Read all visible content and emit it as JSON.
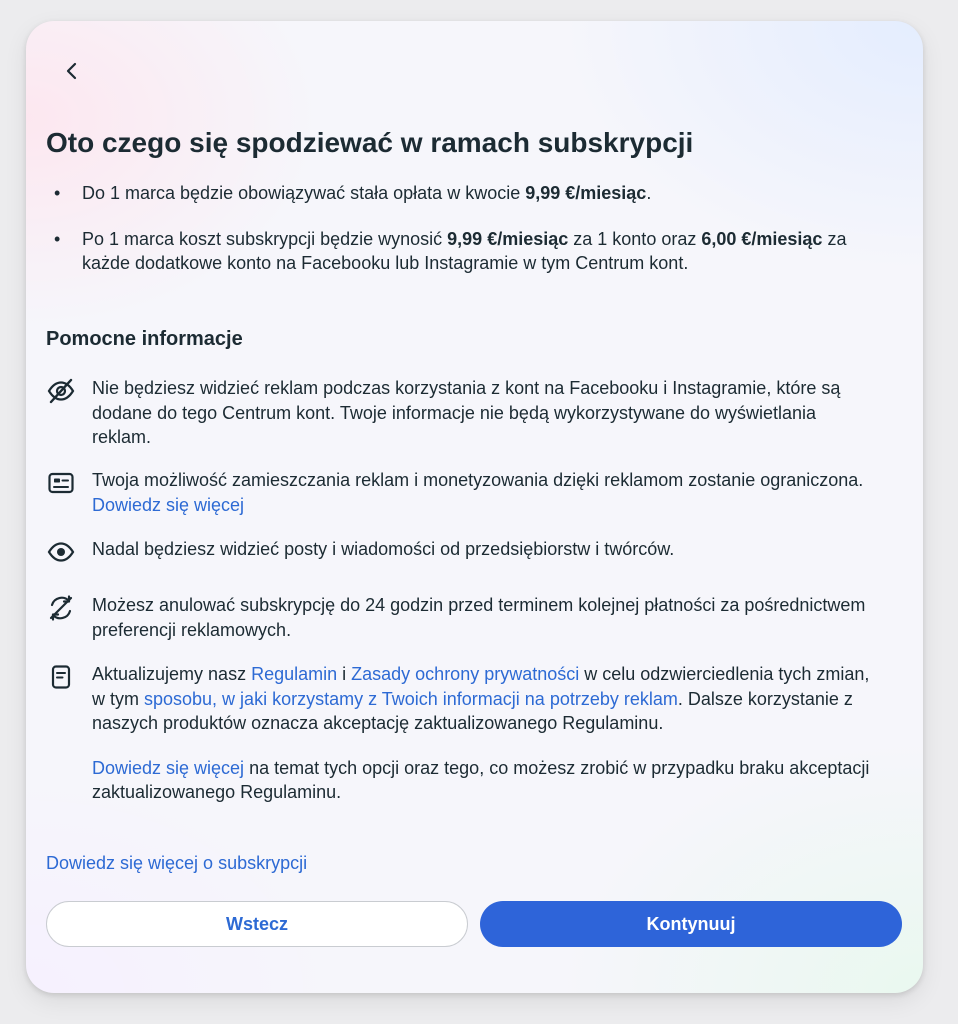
{
  "title": "Oto czego się spodziewać w ramach subskrypcji",
  "bullets": [
    {
      "marker": "•",
      "part1": "Do 1 marca będzie obowiązywać stała opłata w kwocie ",
      "bold1": "9,99 €/miesiąc",
      "part2": "."
    },
    {
      "marker": "•",
      "part1": "Po 1 marca koszt subskrypcji będzie wynosić ",
      "bold1": "9,99 €/miesiąc",
      "part2": " za 1 konto oraz ",
      "bold2": "6,00 €/miesiąc",
      "part3": " za każde dodatkowe konto na Facebooku lub Instagramie w tym Centrum kont."
    }
  ],
  "helpful_heading": "Pomocne informacje",
  "info": [
    {
      "icon": "eye-slash-icon",
      "text": "Nie będziesz widzieć reklam podczas korzystania z kont na Facebooku i Instagramie, które są dodane do tego Centrum kont. Twoje informacje nie będą wykorzystywane do wyświetlania reklam."
    },
    {
      "icon": "ad-card-icon",
      "text": "Twoja możliwość zamieszczania reklam i monetyzowania dzięki reklamom zostanie ograniczona. ",
      "link": "Dowiedz się więcej"
    },
    {
      "icon": "eye-icon",
      "text": "Nadal będziesz widzieć posty i wiadomości od przedsiębiorstw i twórców."
    },
    {
      "icon": "cancel-renew-icon",
      "text": "Możesz anulować subskrypcję do 24 godzin przed terminem kolejnej płatności za pośrednictwem preferencji reklamowych."
    },
    {
      "icon": "document-icon",
      "text1": "Aktualizujemy nasz ",
      "link1": "Regulamin",
      "text2": " i ",
      "link2": "Zasady ochrony prywatności",
      "text3": " w celu odzwierciedlenia tych zmian, w tym ",
      "link3": "sposobu, w jaki korzystamy z Twoich informacji na potrzeby reklam",
      "text4": ". Dalsze korzystanie z naszych produktów oznacza akceptację zaktualizowanego Regulaminu.",
      "p2_link": "Dowiedz się więcej",
      "p2_text": " na temat tych opcji oraz tego, co możesz zrobić w przypadku braku akceptacji zaktualizowanego Regulaminu."
    }
  ],
  "subscription_link": "Dowiedz się więcej o subskrypcji",
  "buttons": {
    "back": "Wstecz",
    "continue": "Kontynuuj"
  },
  "colors": {
    "link": "#2d6ad4",
    "primary": "#2e64d9",
    "text": "#1c2b33"
  }
}
